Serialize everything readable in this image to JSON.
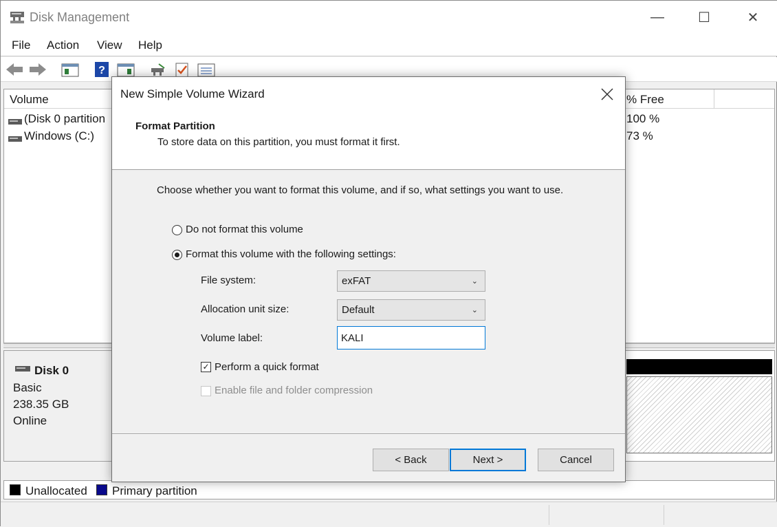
{
  "app": {
    "title": "Disk Management"
  },
  "window_controls": {
    "minimize": "—",
    "maximize": "☐",
    "close": "✕"
  },
  "menu": [
    "File",
    "Action",
    "View",
    "Help"
  ],
  "toolbar": {
    "icons": [
      "back-arrow-icon",
      "forward-arrow-icon",
      "console-tree-icon",
      "help-icon",
      "action-pane-icon",
      "connect-icon",
      "check-icon",
      "properties-icon"
    ]
  },
  "volume_list": {
    "columns": [
      "Volume",
      "% Free"
    ],
    "rows": [
      {
        "volume": "(Disk 0 partition",
        "free": "100 %"
      },
      {
        "volume": "Windows (C:)",
        "free": "73 %"
      }
    ]
  },
  "disk": {
    "name": "Disk 0",
    "type": "Basic",
    "size": "238.35 GB",
    "status": "Online"
  },
  "legend": [
    {
      "label": "Unallocated",
      "color": "#000000"
    },
    {
      "label": "Primary partition",
      "color": "#0a0a8c"
    }
  ],
  "dialog": {
    "title": "New Simple Volume Wizard",
    "close": "✕",
    "heading": "Format Partition",
    "subheading": "To store data on this partition, you must format it first.",
    "instructions": "Choose whether you want to format this volume, and if so, what settings you want to use.",
    "option_no_format": "Do not format this volume",
    "option_format": "Format this volume with the following settings:",
    "selected_option": "format",
    "file_system_label": "File system:",
    "file_system_value": "exFAT",
    "allocation_label": "Allocation unit size:",
    "allocation_value": "Default",
    "volume_label_label": "Volume label:",
    "volume_label_value": "KALI",
    "quick_format_label": "Perform a quick format",
    "quick_format_checked": true,
    "compression_label": "Enable file and folder compression",
    "compression_enabled": false,
    "buttons": {
      "back": "< Back",
      "next": "Next >",
      "cancel": "Cancel"
    }
  }
}
